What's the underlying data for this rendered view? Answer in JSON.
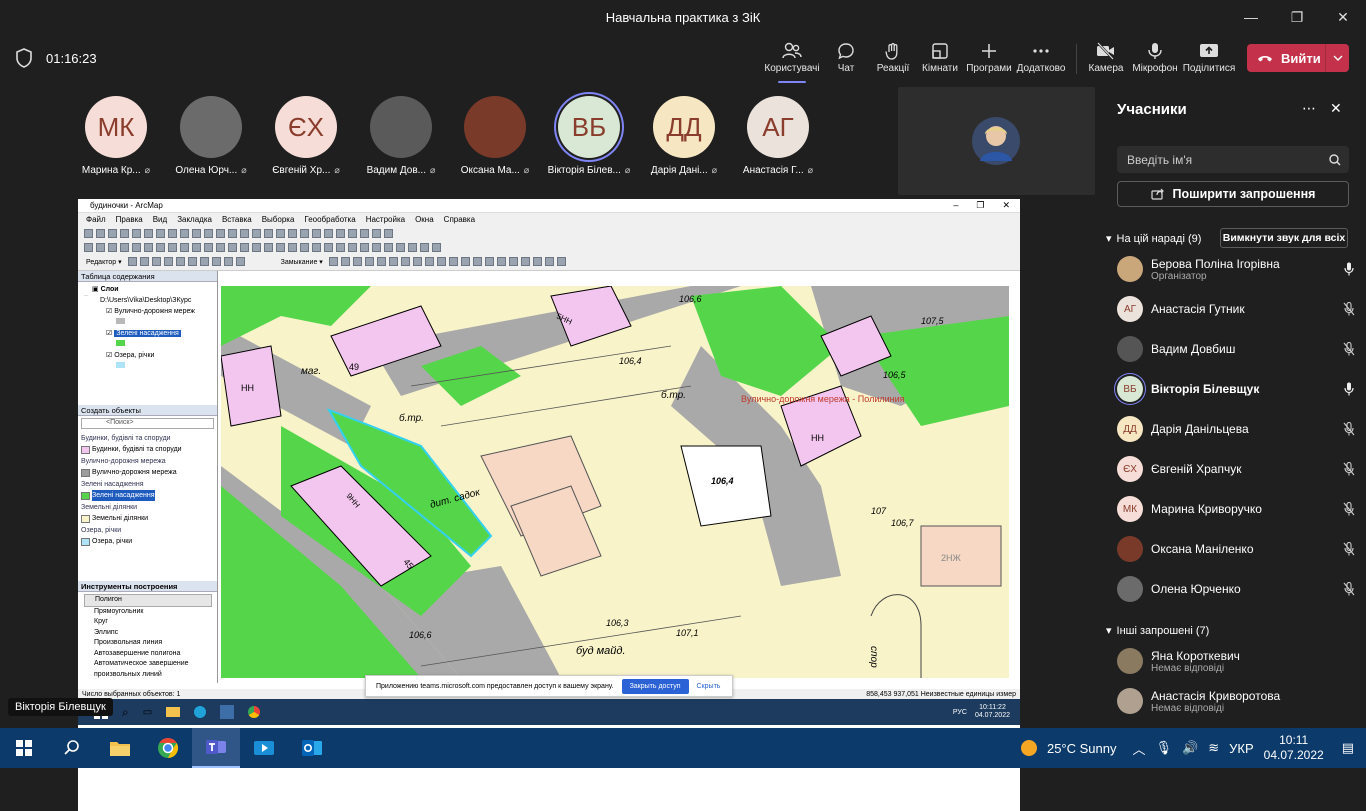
{
  "window": {
    "title": "Навчальна практика з ЗіК"
  },
  "toolbar": {
    "timer": "01:16:23",
    "buttons": [
      {
        "label": "Користувачі",
        "icon": "people-icon"
      },
      {
        "label": "Чат",
        "icon": "chat-icon"
      },
      {
        "label": "Реакції",
        "icon": "reaction-icon"
      },
      {
        "label": "Кімнати",
        "icon": "rooms-icon"
      },
      {
        "label": "Програми",
        "icon": "plus-icon"
      },
      {
        "label": "Додатково",
        "icon": "more-icon"
      },
      {
        "label": "Камера",
        "icon": "camera-off-icon"
      },
      {
        "label": "Мікрофон",
        "icon": "mic-icon"
      },
      {
        "label": "Поділитися",
        "icon": "share-icon"
      }
    ],
    "leave_label": "Вийти"
  },
  "stage": {
    "tiles": [
      {
        "initials": "МК",
        "name": "Марина Кр...",
        "bg": "#f6ddd7",
        "photo": false
      },
      {
        "initials": "",
        "name": "Олена Юрч...",
        "bg": "#6b6b6b",
        "photo": true
      },
      {
        "initials": "ЄХ",
        "name": "Євгеній Хр...",
        "bg": "#f6ddd7",
        "photo": false
      },
      {
        "initials": "",
        "name": "Вадим Дов...",
        "bg": "#5a5a5a",
        "photo": true
      },
      {
        "initials": "",
        "name": "Оксана Ма...",
        "bg": "#7a3a2a",
        "photo": true
      },
      {
        "initials": "ВБ",
        "name": "Вікторія Білев...",
        "bg": "#d9e8d4",
        "photo": false
      },
      {
        "initials": "ДД",
        "name": "Дарія Дані...",
        "bg": "#f6e6c2",
        "photo": false
      },
      {
        "initials": "АГ",
        "name": "Анастасія Г...",
        "bg": "#ece2dc",
        "photo": false
      }
    ],
    "presenter_label": "Вікторія Білевщук"
  },
  "arcmap": {
    "title": "будиночки - ArcMap",
    "menu": [
      "Файл",
      "Правка",
      "Вид",
      "Закладка",
      "Вставка",
      "Выборка",
      "Геообработка",
      "Настройка",
      "Окна",
      "Справка"
    ],
    "editor_label": "Редактор ▾",
    "snapping_label": "Замыкание ▾",
    "toc": {
      "title": "Таблица содержания",
      "layers_root": "Слои",
      "path": "D:\\Users\\Vika\\Desktop\\ЗКурс",
      "layers": [
        "Вулично-дорожня мереж",
        "Зелені насадження",
        "Озера, річки"
      ]
    },
    "create": {
      "title": "Создать объекты",
      "search_placeholder": "<Поиск>",
      "groups": [
        {
          "group": "Будинки, будівлі та споруди",
          "item": "Будинки, будівлі та споруди",
          "color": "#f3c6ef"
        },
        {
          "group": "Вулично-дорожня мережа",
          "item": "Вулично-дорожня мережа",
          "color": "#9b9b9b"
        },
        {
          "group": "Зелені насадження",
          "item": "Зелені насадження",
          "color": "#55d64a"
        },
        {
          "group": "Земельні ділянки",
          "item": "Земельні ділянки",
          "color": "#f8f3c9"
        },
        {
          "group": "Озера, річки",
          "item": "Озера, річки",
          "color": "#aee3f7"
        }
      ]
    },
    "construct": {
      "title": "Инструменты построения",
      "items": [
        "Полигон",
        "Прямоугольник",
        "Круг",
        "Эллипс",
        "Произвольная линия",
        "Автозавершение полигона",
        "Автоматическое завершение",
        "произвольных линий"
      ]
    },
    "map_labels": {
      "mag": "маг.",
      "btr1": "б.тр.",
      "btr2": "б.тр.",
      "sadok": "дит. садок",
      "height1": "106,4",
      "height2": "106,4",
      "height3": "106,6",
      "height4": "106,5",
      "height5": "106,3",
      "height6": "106,6",
      "height7": "107,1",
      "height8": "107,5",
      "height9": "106,7",
      "height10": "107",
      "budmaid": "буд майд.",
      "sport": "спор",
      "nn": "НН",
      "ch5": "5НН",
      "ch2": "2НЖ",
      "ch9": "9НН",
      "num45": "45",
      "num49": "49",
      "overlay": "Вулично-дорожня мережа - Полилиния"
    },
    "status_left": "Число выбранных объектов: 1",
    "status_right": "858,453  937,051 Неизвестные единицы измер",
    "notice": {
      "text": "Приложению teams.microsoft.com предоставлен доступ к вашему экрану.",
      "stop": "Закрыть доступ",
      "hide": "Скрыть"
    },
    "vm_clock_time": "10:11:22",
    "vm_clock_date": "04.07.2022",
    "vm_lang": "РУС"
  },
  "panel": {
    "title": "Учасники",
    "search_placeholder": "Введіть ім'я",
    "invite_label": "Поширити запрошення",
    "section_in": "На цій нараді (9)",
    "mute_all": "Вимкнути звук для всіх",
    "participants": [
      {
        "name": "Берова Поліна Ігорівна",
        "sub": "Організатор",
        "initials": "",
        "bg": "#c9a77a",
        "mic": "on",
        "bold": false
      },
      {
        "name": "Анастасія Гутник",
        "sub": "",
        "initials": "АГ",
        "bg": "#ece2dc",
        "mic": "off",
        "bold": false
      },
      {
        "name": "Вадим Довбиш",
        "sub": "",
        "initials": "",
        "bg": "#555555",
        "mic": "off",
        "bold": false
      },
      {
        "name": "Вікторія Білевщук",
        "sub": "",
        "initials": "ВБ",
        "bg": "#d9e8d4",
        "mic": "on",
        "bold": true
      },
      {
        "name": "Дарія Данільцева",
        "sub": "",
        "initials": "ДД",
        "bg": "#f6e6c2",
        "mic": "off",
        "bold": false
      },
      {
        "name": "Євгеній Храпчук",
        "sub": "",
        "initials": "ЄХ",
        "bg": "#f6ddd7",
        "mic": "off",
        "bold": false
      },
      {
        "name": "Марина Криворучко",
        "sub": "",
        "initials": "МК",
        "bg": "#f6ddd7",
        "mic": "off",
        "bold": false
      },
      {
        "name": "Оксана Маніленко",
        "sub": "",
        "initials": "",
        "bg": "#7a3a2a",
        "mic": "off",
        "bold": false
      },
      {
        "name": "Олена Юрченко",
        "sub": "",
        "initials": "",
        "bg": "#6b6b6b",
        "mic": "off",
        "bold": false
      }
    ],
    "section_other": "Інші запрошені (7)",
    "others": [
      {
        "name": "Яна Короткевич",
        "sub": "Немає відповіді",
        "bg": "#8a7a60"
      },
      {
        "name": "Анастасія Криворотова",
        "sub": "Немає відповіді",
        "bg": "#b0a090"
      }
    ]
  },
  "taskbar": {
    "weather": "25°C  Sunny",
    "lang": "УКР",
    "time": "10:11",
    "date": "04.07.2022"
  }
}
